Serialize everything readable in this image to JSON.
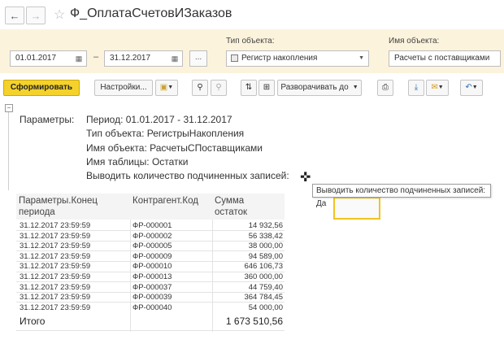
{
  "window": {
    "title": "Ф_ОплатаСчетовИЗаказов",
    "back_glyph": "←",
    "forward_glyph": "→",
    "star_glyph": "☆"
  },
  "filters": {
    "date_from": "01.01.2017",
    "date_to": "31.12.2017",
    "dash": "–",
    "dots": "...",
    "object_type_label": "Тип объекта:",
    "object_type_value": "Регистр накопления",
    "object_name_label": "Имя объекта:",
    "object_name_value": "Расчеты с поставщиками"
  },
  "toolbar": {
    "generate": "Сформировать",
    "settings": "Настройки...",
    "expand": "Разворачивать до"
  },
  "params": {
    "label": "Параметры:",
    "period": "Период: 01.01.2017 - 31.12.2017",
    "object_type": "Тип объекта: РегистрыНакопления",
    "object_name": "Имя объекта: РасчетыСПоставщиками",
    "table_name": "Имя таблицы: Остатки",
    "show_count": "Выводить количество подчиненных записей:"
  },
  "tooltip": "Выводить количество подчиненных записей: Да",
  "table": {
    "headers": {
      "col1_line1": "Параметры.Конец",
      "col1_line2": "периода",
      "col2": "Контрагент.Код",
      "col3_line1": "Сумма",
      "col3_line2": "остаток"
    },
    "rows": [
      {
        "date": "31.12.2017 23:59:59",
        "code": "ФР-000001",
        "sum": "14 932,56"
      },
      {
        "date": "31.12.2017 23:59:59",
        "code": "ФР-000002",
        "sum": "56 338,42"
      },
      {
        "date": "31.12.2017 23:59:59",
        "code": "ФР-000005",
        "sum": "38 000,00"
      },
      {
        "date": "31.12.2017 23:59:59",
        "code": "ФР-000009",
        "sum": "94 589,00"
      },
      {
        "date": "31.12.2017 23:59:59",
        "code": "ФР-000010",
        "sum": "646 106,73"
      },
      {
        "date": "31.12.2017 23:59:59",
        "code": "ФР-000013",
        "sum": "360 000,00"
      },
      {
        "date": "31.12.2017 23:59:59",
        "code": "ФР-000037",
        "sum": "44 759,40"
      },
      {
        "date": "31.12.2017 23:59:59",
        "code": "ФР-000039",
        "sum": "364 784,45"
      },
      {
        "date": "31.12.2017 23:59:59",
        "code": "ФР-000040",
        "sum": "54 000,00"
      }
    ],
    "total_label": "Итого",
    "total_value": "1 673 510,56"
  },
  "colors": {
    "accent": "#f5d22b",
    "filter_bg": "#fbf3dc"
  }
}
